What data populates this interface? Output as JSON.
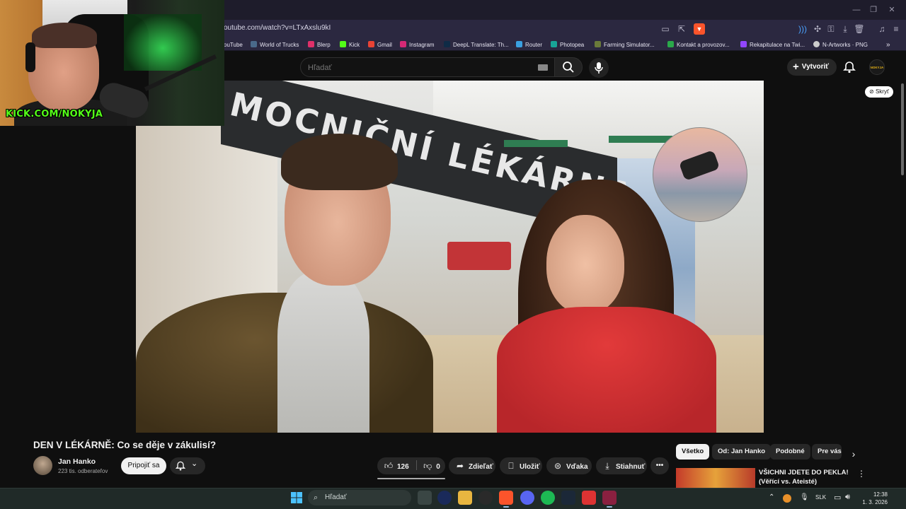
{
  "browser": {
    "url": "outube.com/watch?v=LTxAxslu9kI",
    "bookmarks": [
      {
        "label": "ouTube",
        "color": "#ff0000"
      },
      {
        "label": "World of Trucks",
        "color": "#4a6a8a"
      },
      {
        "label": "Blerp",
        "color": "#e0306a"
      },
      {
        "label": "Kick",
        "color": "#53fc18"
      },
      {
        "label": "Gmail",
        "color": "#ea4335"
      },
      {
        "label": "Instagram",
        "color": "#d62976"
      },
      {
        "label": "DeepL Translate: Th...",
        "color": "#0f2b46"
      },
      {
        "label": "Router",
        "color": "#3aa0e0"
      },
      {
        "label": "Photopea",
        "color": "#18a497"
      },
      {
        "label": "Farming Simulator...",
        "color": "#6a7a3a"
      },
      {
        "label": "Kontakt a provozov...",
        "color": "#2aa84a"
      },
      {
        "label": "Rekapitulace na Twi...",
        "color": "#9146ff"
      },
      {
        "label": "N-Artworks · PNG",
        "color": "#cccccc"
      }
    ],
    "more_label": "»"
  },
  "header": {
    "search_placeholder": "Hľadať",
    "create_label": "Vytvoriť",
    "avatar_text": "NOKYJA"
  },
  "player": {
    "banner_text": "MOCNIČNÍ LÉKÁRNA",
    "hide_label": "Skryť"
  },
  "webcam": {
    "label": "KICK.COM/NOKYJA"
  },
  "video": {
    "title": "DEN V LÉKÁRNĚ: Co se děje v zákulisí?",
    "channel": "Jan Hanko",
    "subscribers": "223 tis. odberateľov",
    "join_label": "Pripojiť sa",
    "likes": "126",
    "dislikes": "0",
    "share_label": "Zdieľať",
    "save_label": "Uložiť",
    "thanks_label": "Vďaka",
    "download_label": "Stiahnuť"
  },
  "sidebar": {
    "chips": [
      "Všetko",
      "Od: Jan Hanko",
      "Podobné",
      "Pre vás"
    ],
    "recommendation_title": "VŠICHNI JDETE DO PEKLA! (Věřící vs. Ateisté)"
  },
  "taskbar": {
    "search_placeholder": "Hľadať",
    "language": "SLK",
    "time": "12:38",
    "date": "1. 3. 2026"
  }
}
